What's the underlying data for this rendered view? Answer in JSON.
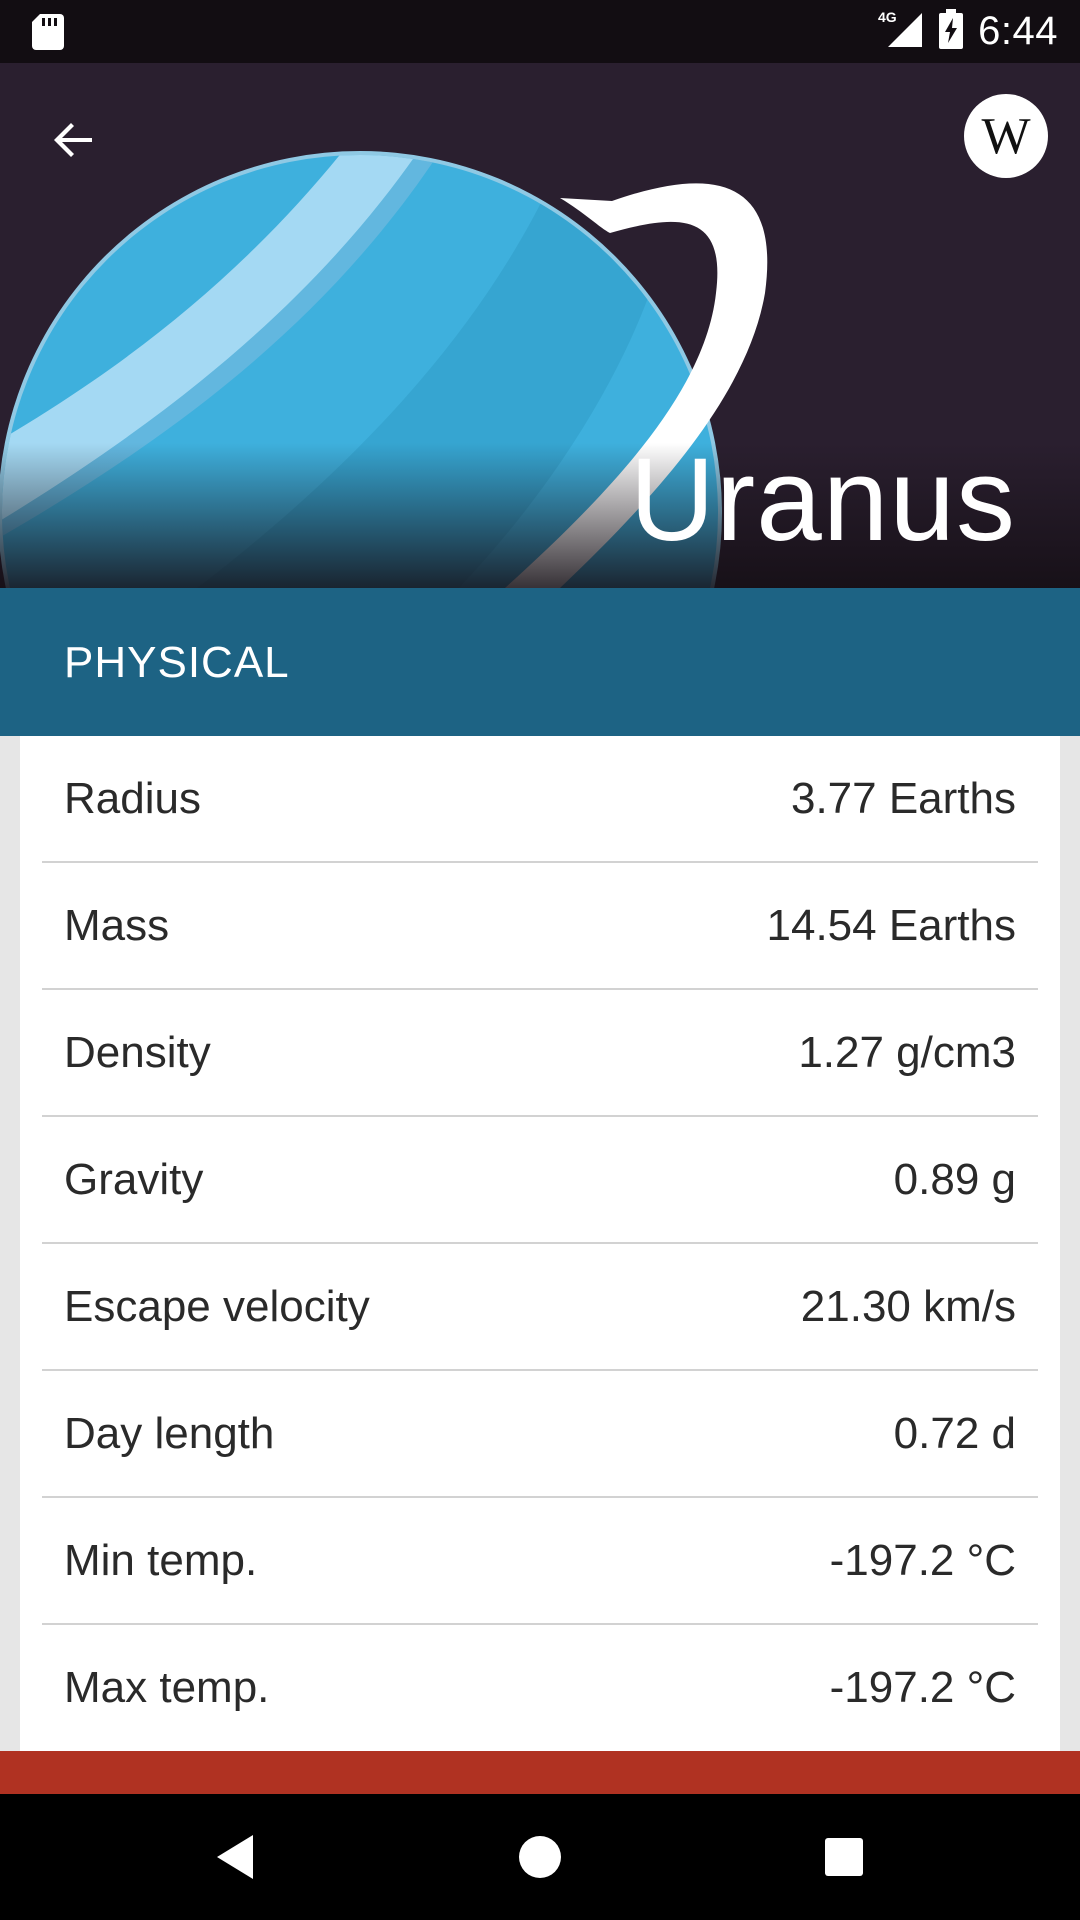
{
  "status_bar": {
    "time": "6:44",
    "network": "4G",
    "icons": [
      "sd-card-icon",
      "signal-icon",
      "battery-charging-icon"
    ]
  },
  "header": {
    "title": "Uranus",
    "back_icon": "arrow-left-icon",
    "wiki_label": "W"
  },
  "section": {
    "title": "PHYSICAL"
  },
  "properties": [
    {
      "label": "Radius",
      "value": "3.77 Earths"
    },
    {
      "label": "Mass",
      "value": "14.54 Earths"
    },
    {
      "label": "Density",
      "value": "1.27 g/cm3"
    },
    {
      "label": "Gravity",
      "value": "0.89 g"
    },
    {
      "label": "Escape velocity",
      "value": "21.30 km/s"
    },
    {
      "label": "Day length",
      "value": "0.72 d"
    },
    {
      "label": "Min temp.",
      "value": "-197.2 °C"
    },
    {
      "label": "Max temp.",
      "value": "-197.2 °C"
    }
  ],
  "nav": {
    "back": "nav-back-icon",
    "home": "nav-home-icon",
    "recents": "nav-recents-icon"
  },
  "colors": {
    "header_bg": "#2a1f2f",
    "section_bar": "#1d6384",
    "accent_band": "#b03222",
    "planet": "#3eb0dd"
  }
}
